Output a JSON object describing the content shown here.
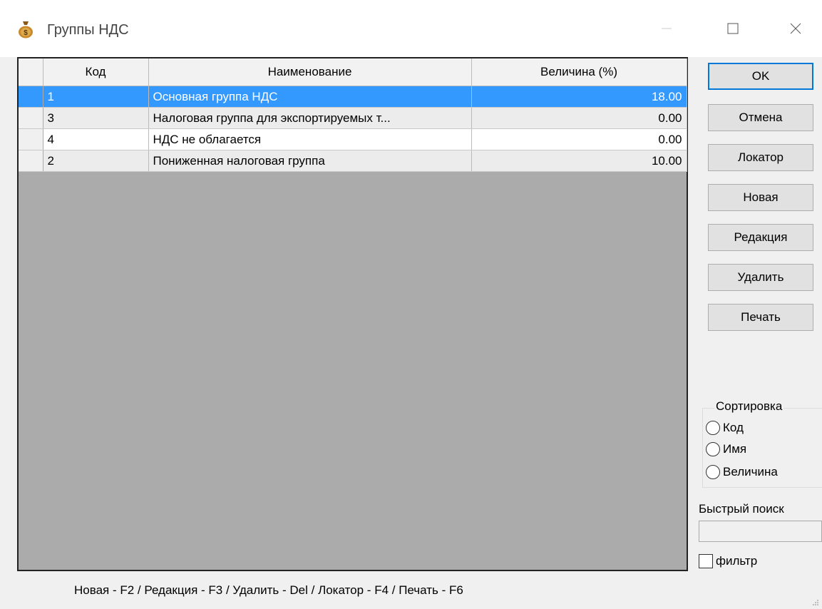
{
  "window": {
    "title": "Группы НДС",
    "icon": "money-bag-icon"
  },
  "table": {
    "columns": [
      "Код",
      "Наименование",
      "Величина (%)"
    ],
    "rows": [
      {
        "code": "1",
        "name": "Основная группа НДС",
        "value": "18.00",
        "selected": true
      },
      {
        "code": "3",
        "name": "Налоговая группа для экспортируемых т...",
        "value": "0.00"
      },
      {
        "code": "4",
        "name": "НДС не облагается",
        "value": "0.00"
      },
      {
        "code": "2",
        "name": "Пониженная налоговая группа",
        "value": "10.00"
      }
    ]
  },
  "buttons": {
    "ok": "OK",
    "cancel": "Отмена",
    "locator": "Локатор",
    "new": "Новая",
    "edit": "Редакция",
    "delete": "Удалить",
    "print": "Печать"
  },
  "sort": {
    "legend": "Сортировка",
    "options": [
      "Код",
      "Имя",
      "Величина"
    ]
  },
  "quick_search": {
    "label": "Быстрый поиск",
    "value": ""
  },
  "filter": {
    "label": "фильтр",
    "checked": false
  },
  "hint": "Новая - F2 / Редакция - F3 / Удалить - Del / Локатор - F4 / Печать - F6",
  "colors": {
    "selection": "#3399ff",
    "grid_background": "#ababab",
    "default_button_border": "#0078d7"
  }
}
